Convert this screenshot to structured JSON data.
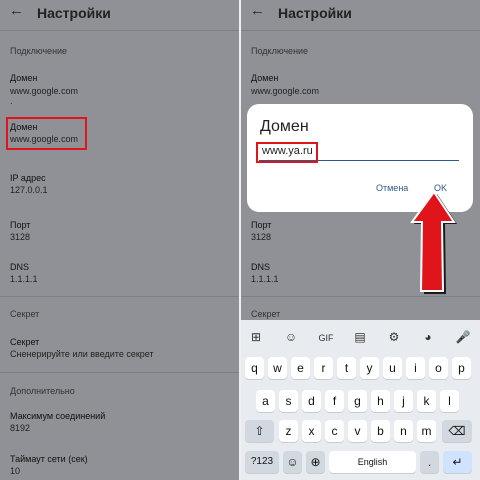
{
  "left": {
    "header": {
      "back": "←",
      "title": "Настройки"
    },
    "section_connection": "Подключение",
    "domain1": {
      "title": "Домен",
      "value": "www.google.com"
    },
    "dot": ".",
    "domain2": {
      "title": "Домен",
      "value": "www.google.com"
    },
    "ip": {
      "title": "IP адрес",
      "value": "127.0.0.1"
    },
    "port": {
      "title": "Порт",
      "value": "3128"
    },
    "dns": {
      "title": "DNS",
      "value": "1.1.1.1"
    },
    "section_secret": "Секрет",
    "secret": {
      "title": "Секрет",
      "value": "Сненерируйте или введите секрет"
    },
    "section_additional": "Дополнительно",
    "max_conn": {
      "title": "Максимум соединений",
      "value": "8192"
    },
    "timeout": {
      "title": "Таймаут сети (сек)",
      "value": "10"
    }
  },
  "right": {
    "header": {
      "back": "←",
      "title": "Настройки"
    },
    "section_connection": "Подключение",
    "domain1": {
      "title": "Домен",
      "value": "www.google.com"
    },
    "port": {
      "title": "Порт",
      "value": "3128"
    },
    "dns": {
      "title": "DNS",
      "value": "1.1.1.1"
    },
    "section_secret": "Секрет",
    "dialog": {
      "title": "Домен",
      "value": "www.ya.ru",
      "cancel": "Отмена",
      "ok": "OK"
    }
  },
  "keyboard": {
    "toolbar": [
      "⊞",
      "☺",
      "GIF",
      "▤",
      "⚙",
      "◕",
      "🎤"
    ],
    "row1": [
      "q",
      "w",
      "e",
      "r",
      "t",
      "y",
      "u",
      "i",
      "o",
      "p"
    ],
    "row2": [
      "a",
      "s",
      "d",
      "f",
      "g",
      "h",
      "j",
      "k",
      "l"
    ],
    "row3": [
      "z",
      "x",
      "c",
      "v",
      "b",
      "n",
      "m"
    ],
    "shift": "⇧",
    "backspace": "⌫",
    "symbols": "?123",
    "emoji": "☺",
    "globe": "⊕",
    "space": "English",
    "period": ".",
    "enter": "↵"
  },
  "colors": {
    "highlight": "#e0141b",
    "arrow": "#e0141b",
    "accent": "#2e5b8c"
  }
}
